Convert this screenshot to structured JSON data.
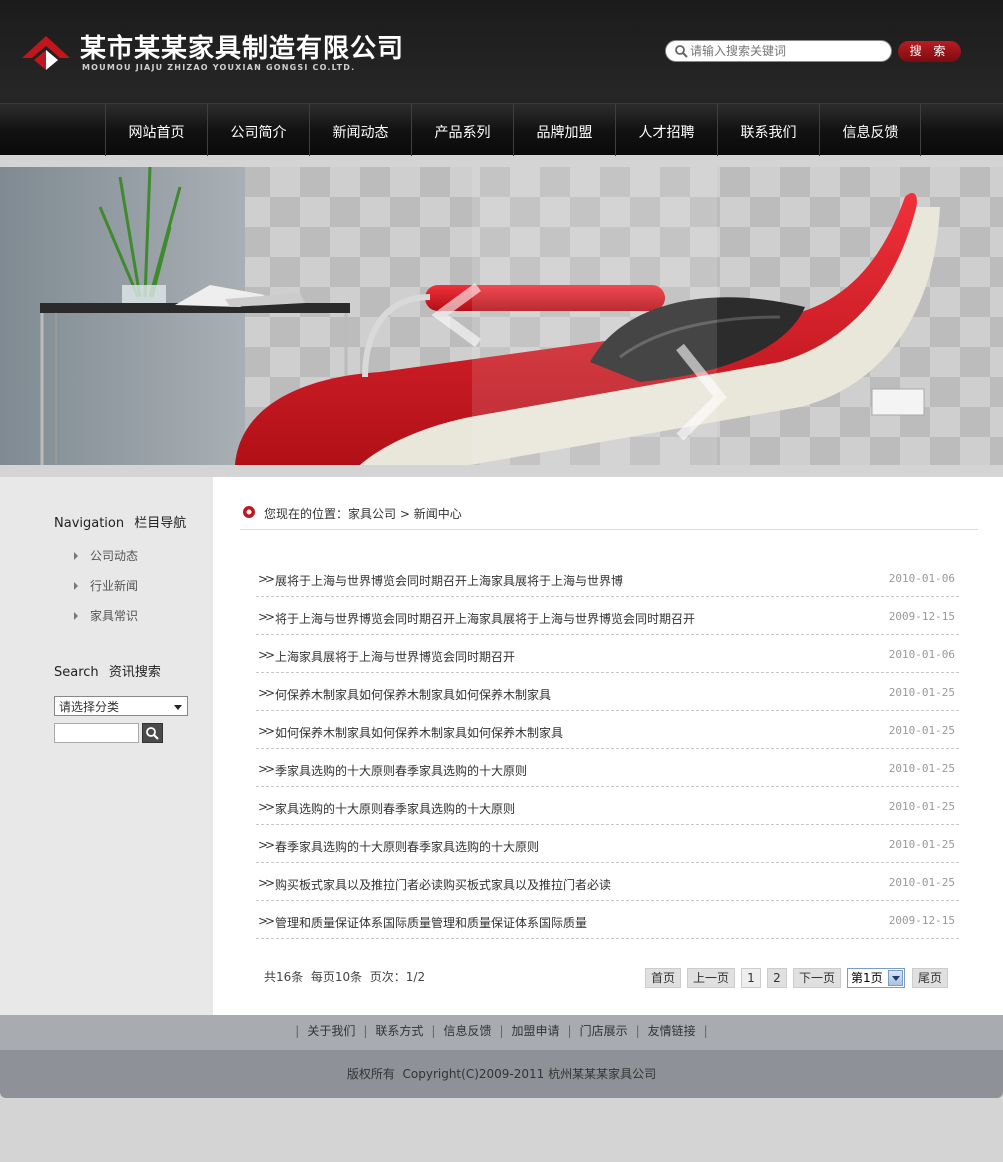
{
  "header": {
    "company_name": "某市某某家具制造有限公司",
    "company_sub": "MOUMOU JIAJU ZHIZAO YOUXIAN GONGSI CO.LTD.",
    "search_placeholder": "请输入搜索关键词",
    "search_button": "搜 索"
  },
  "nav": {
    "items": [
      "网站首页",
      "公司简介",
      "新闻动态",
      "产品系列",
      "品牌加盟",
      "人才招聘",
      "联系我们",
      "信息反馈"
    ]
  },
  "sidebar": {
    "nav_title_en": "Navigation",
    "nav_title_cn": "栏目导航",
    "links": [
      "公司动态",
      "行业新闻",
      "家具常识"
    ],
    "search_title_en": "Search",
    "search_title_cn": "资讯搜索",
    "category_select": "请选择分类"
  },
  "breadcrumb": {
    "prefix": "您现在的位置：",
    "home": "家具公司",
    "sep": " > ",
    "current": "新闻中心"
  },
  "news": [
    {
      "title": "展将于上海与世界博览会同时期召开上海家具展将于上海与世界博",
      "date": "2010-01-06"
    },
    {
      "title": "将于上海与世界博览会同时期召开上海家具展将于上海与世界博览会同时期召开",
      "date": "2009-12-15"
    },
    {
      "title": "上海家具展将于上海与世界博览会同时期召开",
      "date": "2010-01-06"
    },
    {
      "title": "何保养木制家具如何保养木制家具如何保养木制家具",
      "date": "2010-01-25"
    },
    {
      "title": "如何保养木制家具如何保养木制家具如何保养木制家具",
      "date": "2010-01-25"
    },
    {
      "title": "季家具选购的十大原则春季家具选购的十大原则",
      "date": "2010-01-25"
    },
    {
      "title": "家具选购的十大原则春季家具选购的十大原则",
      "date": "2010-01-25"
    },
    {
      "title": "春季家具选购的十大原则春季家具选购的十大原则",
      "date": "2010-01-25"
    },
    {
      "title": "购买板式家具以及推拉门者必读购买板式家具以及推拉门者必读",
      "date": "2010-01-25"
    },
    {
      "title": "管理和质量保证体系国际质量管理和质量保证体系国际质量",
      "date": "2009-12-15"
    }
  ],
  "pager": {
    "info": "共16条  每页10条  页次：1/2",
    "first": "首页",
    "prev": "上一页",
    "page1": "1",
    "page2": "2",
    "next": "下一页",
    "select": "第1页",
    "last": "尾页"
  },
  "footer": {
    "links": [
      "关于我们",
      "联系方式",
      "信息反馈",
      "加盟申请",
      "门店展示",
      "友情链接"
    ],
    "copyright": "版权所有  Copyright(C)2009-2011 杭州某某某家具公司"
  },
  "colors": {
    "accent_red": "#b81d22",
    "header_bg": "#1e1e1e",
    "sidebar_bg": "#e8e8e8"
  }
}
